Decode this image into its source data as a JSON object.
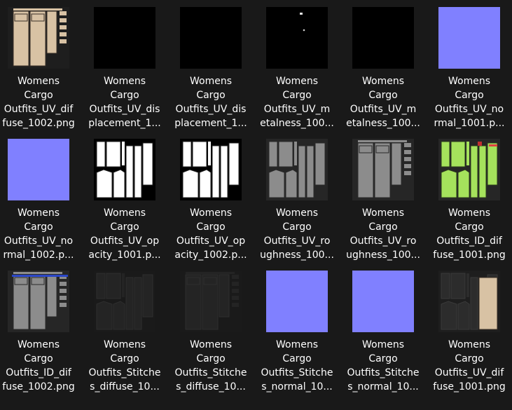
{
  "colors": {
    "background": "#191919",
    "normal_map": "#8080ff",
    "text": "#ffffff"
  },
  "files": [
    {
      "label": "Womens\nCargo\nOutfits_UV_dif\nfuse_1002.png",
      "thumb": "diffuse-tan"
    },
    {
      "label": "Womens\nCargo\nOutfits_UV_dis\nplacement_1...",
      "thumb": "black"
    },
    {
      "label": "Womens\nCargo\nOutfits_UV_dis\nplacement_1...",
      "thumb": "black"
    },
    {
      "label": "Womens\nCargo\nOutfits_UV_m\netalness_100...",
      "thumb": "black-dots"
    },
    {
      "label": "Womens\nCargo\nOutfits_UV_m\netalness_100...",
      "thumb": "black"
    },
    {
      "label": "Womens\nCargo\nOutfits_UV_no\nrmal_1001.p...",
      "thumb": "normal"
    },
    {
      "label": "Womens\nCargo\nOutfits_UV_no\nrmal_1002.p...",
      "thumb": "normal"
    },
    {
      "label": "Womens\nCargo\nOutfits_UV_op\nacity_1001.p...",
      "thumb": "opacity"
    },
    {
      "label": "Womens\nCargo\nOutfits_UV_op\nacity_1002.p...",
      "thumb": "opacity"
    },
    {
      "label": "Womens\nCargo\nOutfits_UV_ro\nughness_100...",
      "thumb": "gray-garment"
    },
    {
      "label": "Womens\nCargo\nOutfits_UV_ro\nughness_100...",
      "thumb": "gray-pants"
    },
    {
      "label": "Womens\nCargo\nOutfits_ID_dif\nfuse_1001.png",
      "thumb": "green-id"
    },
    {
      "label": "Womens\nCargo\nOutfits_ID_dif\nfuse_1002.png",
      "thumb": "gray-blue"
    },
    {
      "label": "Womens\nCargo\nOutfits_Stitche\ns_diffuse_10...",
      "thumb": "dark-garment"
    },
    {
      "label": "Womens\nCargo\nOutfits_Stitche\ns_diffuse_10...",
      "thumb": "dark-pants"
    },
    {
      "label": "Womens\nCargo\nOutfits_Stitche\ns_normal_10...",
      "thumb": "normal"
    },
    {
      "label": "Womens\nCargo\nOutfits_Stitche\ns_normal_10...",
      "thumb": "normal"
    },
    {
      "label": "Womens\nCargo\nOutfits_UV_dif\nfuse_1001.png",
      "thumb": "diffuse-dark-tan"
    }
  ]
}
